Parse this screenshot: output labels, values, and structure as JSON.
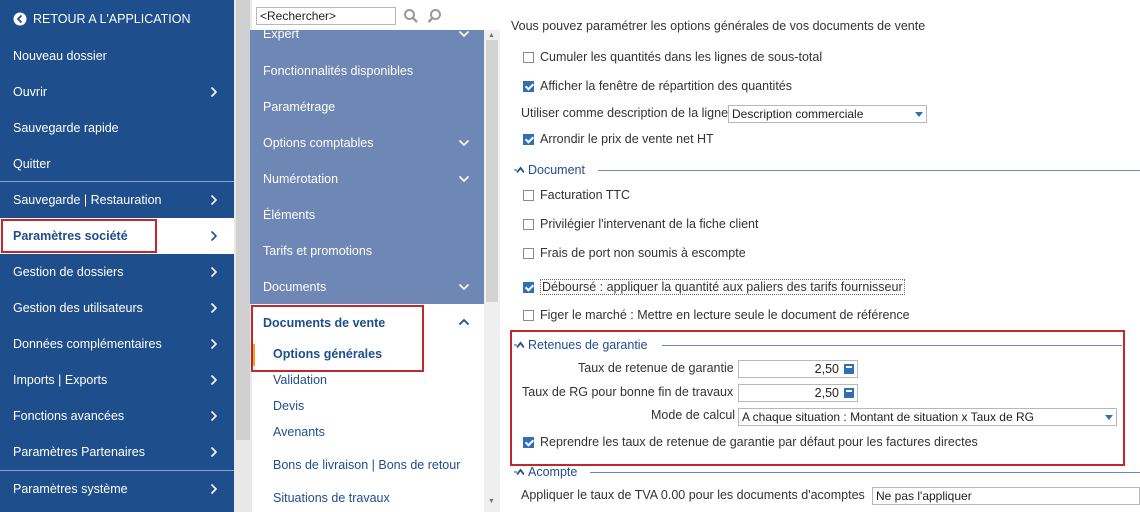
{
  "nav": {
    "back_label": "RETOUR A L'APPLICATION",
    "items": [
      {
        "label": "Nouveau dossier"
      },
      {
        "label": "Ouvrir"
      },
      {
        "label": "Sauvegarde rapide"
      },
      {
        "label": "Quitter"
      },
      {
        "label": "Sauvegarde | Restauration"
      },
      {
        "label": "Paramètres société"
      },
      {
        "label": "Gestion de dossiers"
      },
      {
        "label": "Gestion des utilisateurs"
      },
      {
        "label": "Données complémentaires"
      },
      {
        "label": "Imports | Exports"
      },
      {
        "label": "Fonctions avancées"
      },
      {
        "label": "Paramètres Partenaires"
      },
      {
        "label": "Paramètres système"
      }
    ]
  },
  "search": {
    "placeholder": "<Rechercher>"
  },
  "middle": {
    "items": [
      {
        "label": "Expert"
      },
      {
        "label": "Fonctionnalités disponibles"
      },
      {
        "label": "Paramétrage"
      },
      {
        "label": "Options comptables"
      },
      {
        "label": "Numérotation"
      },
      {
        "label": "Éléments"
      },
      {
        "label": "Tarifs et promotions"
      },
      {
        "label": "Documents"
      }
    ],
    "docs_header": "Documents de vente",
    "sub_items": [
      {
        "label": "Options générales"
      },
      {
        "label": "Validation"
      },
      {
        "label": "Devis"
      },
      {
        "label": "Avenants"
      },
      {
        "label": "Bons de livraison | Bons de retour"
      },
      {
        "label": "Situations de travaux"
      }
    ]
  },
  "content": {
    "intro": "Vous pouvez paramétrer les options générales de vos documents de vente",
    "opt_cumuler": "Cumuler les quantités dans les lignes de sous-total",
    "opt_afficher": "Afficher la fenêtre de répartition des quantités",
    "desc_label": "Utiliser comme description de la ligne",
    "desc_value": "Description commerciale",
    "opt_arrondir": "Arrondir le prix de vente net HT",
    "document_title": "Document",
    "opt_facturation": "Facturation TTC",
    "opt_privilegier": "Privilégier l'intervenant de la fiche client",
    "opt_frais": "Frais de port non soumis à escompte",
    "opt_debourse": "Déboursé : appliquer la quantité aux paliers des tarifs fournisseur",
    "opt_figer": "Figer le marché : Mettre en lecture seule le document de référence",
    "retenues_title": "Retenues de garantie",
    "taux_label": "Taux de retenue de garantie",
    "taux_value": "2,50",
    "taux_rg_label": "Taux de RG pour bonne fin de travaux",
    "taux_rg_value": "2,50",
    "mode_label": "Mode de calcul",
    "mode_value": "A chaque situation : Montant de situation x Taux de RG",
    "opt_reprendre": "Reprendre les taux de retenue de garantie par défaut pour les factures directes",
    "acompte_title": "Acompte",
    "tva_label": "Appliquer le taux de TVA 0.00 pour les documents d'acomptes",
    "tva_value": "Ne pas l'appliquer"
  },
  "colors": {
    "nav_bg": "#1f4e8c",
    "mid_list_bg": "#6f87b4",
    "highlight_outline": "#c0282e",
    "active_bar": "#f4a020",
    "checkbox_blue": "#2f6fb4"
  }
}
